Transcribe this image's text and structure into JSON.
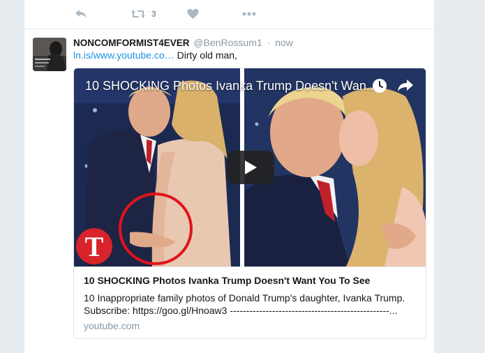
{
  "previous_tweet": {
    "actions": {
      "reply_icon": "reply-icon",
      "retweet_icon": "retweet-icon",
      "retweet_count": "3",
      "like_icon": "heart-icon",
      "more_icon": "more-icon"
    }
  },
  "tweet": {
    "fullname": "NONCOMFORMIST4EVER",
    "username": "@BenRossum1",
    "separator": "·",
    "time": "now",
    "link_text": "ln.is/www.youtube.co…",
    "text_after_link": " Dirty old man,",
    "card": {
      "video_title": "10 SHOCKING Photos Ivanka Trump Doesn't Wan...",
      "channel_logo_letter": "T",
      "title": "10 SHOCKING Photos Ivanka Trump Doesn't Want You To See",
      "description_line1": "10 Inappropriate family photos of Donald Trump's daughter, Ivanka Trump.",
      "description_line2": "Subscribe: https://goo.gl/Hnoaw3 -------------------------------------------------...",
      "domain": "youtube.com"
    }
  },
  "colors": {
    "background": "#e6ecf0",
    "link": "#1b95e0",
    "muted": "#8899a6",
    "border": "#e1e8ed",
    "channel_red": "#d8232a",
    "highlight_circle": "#e0141b"
  }
}
